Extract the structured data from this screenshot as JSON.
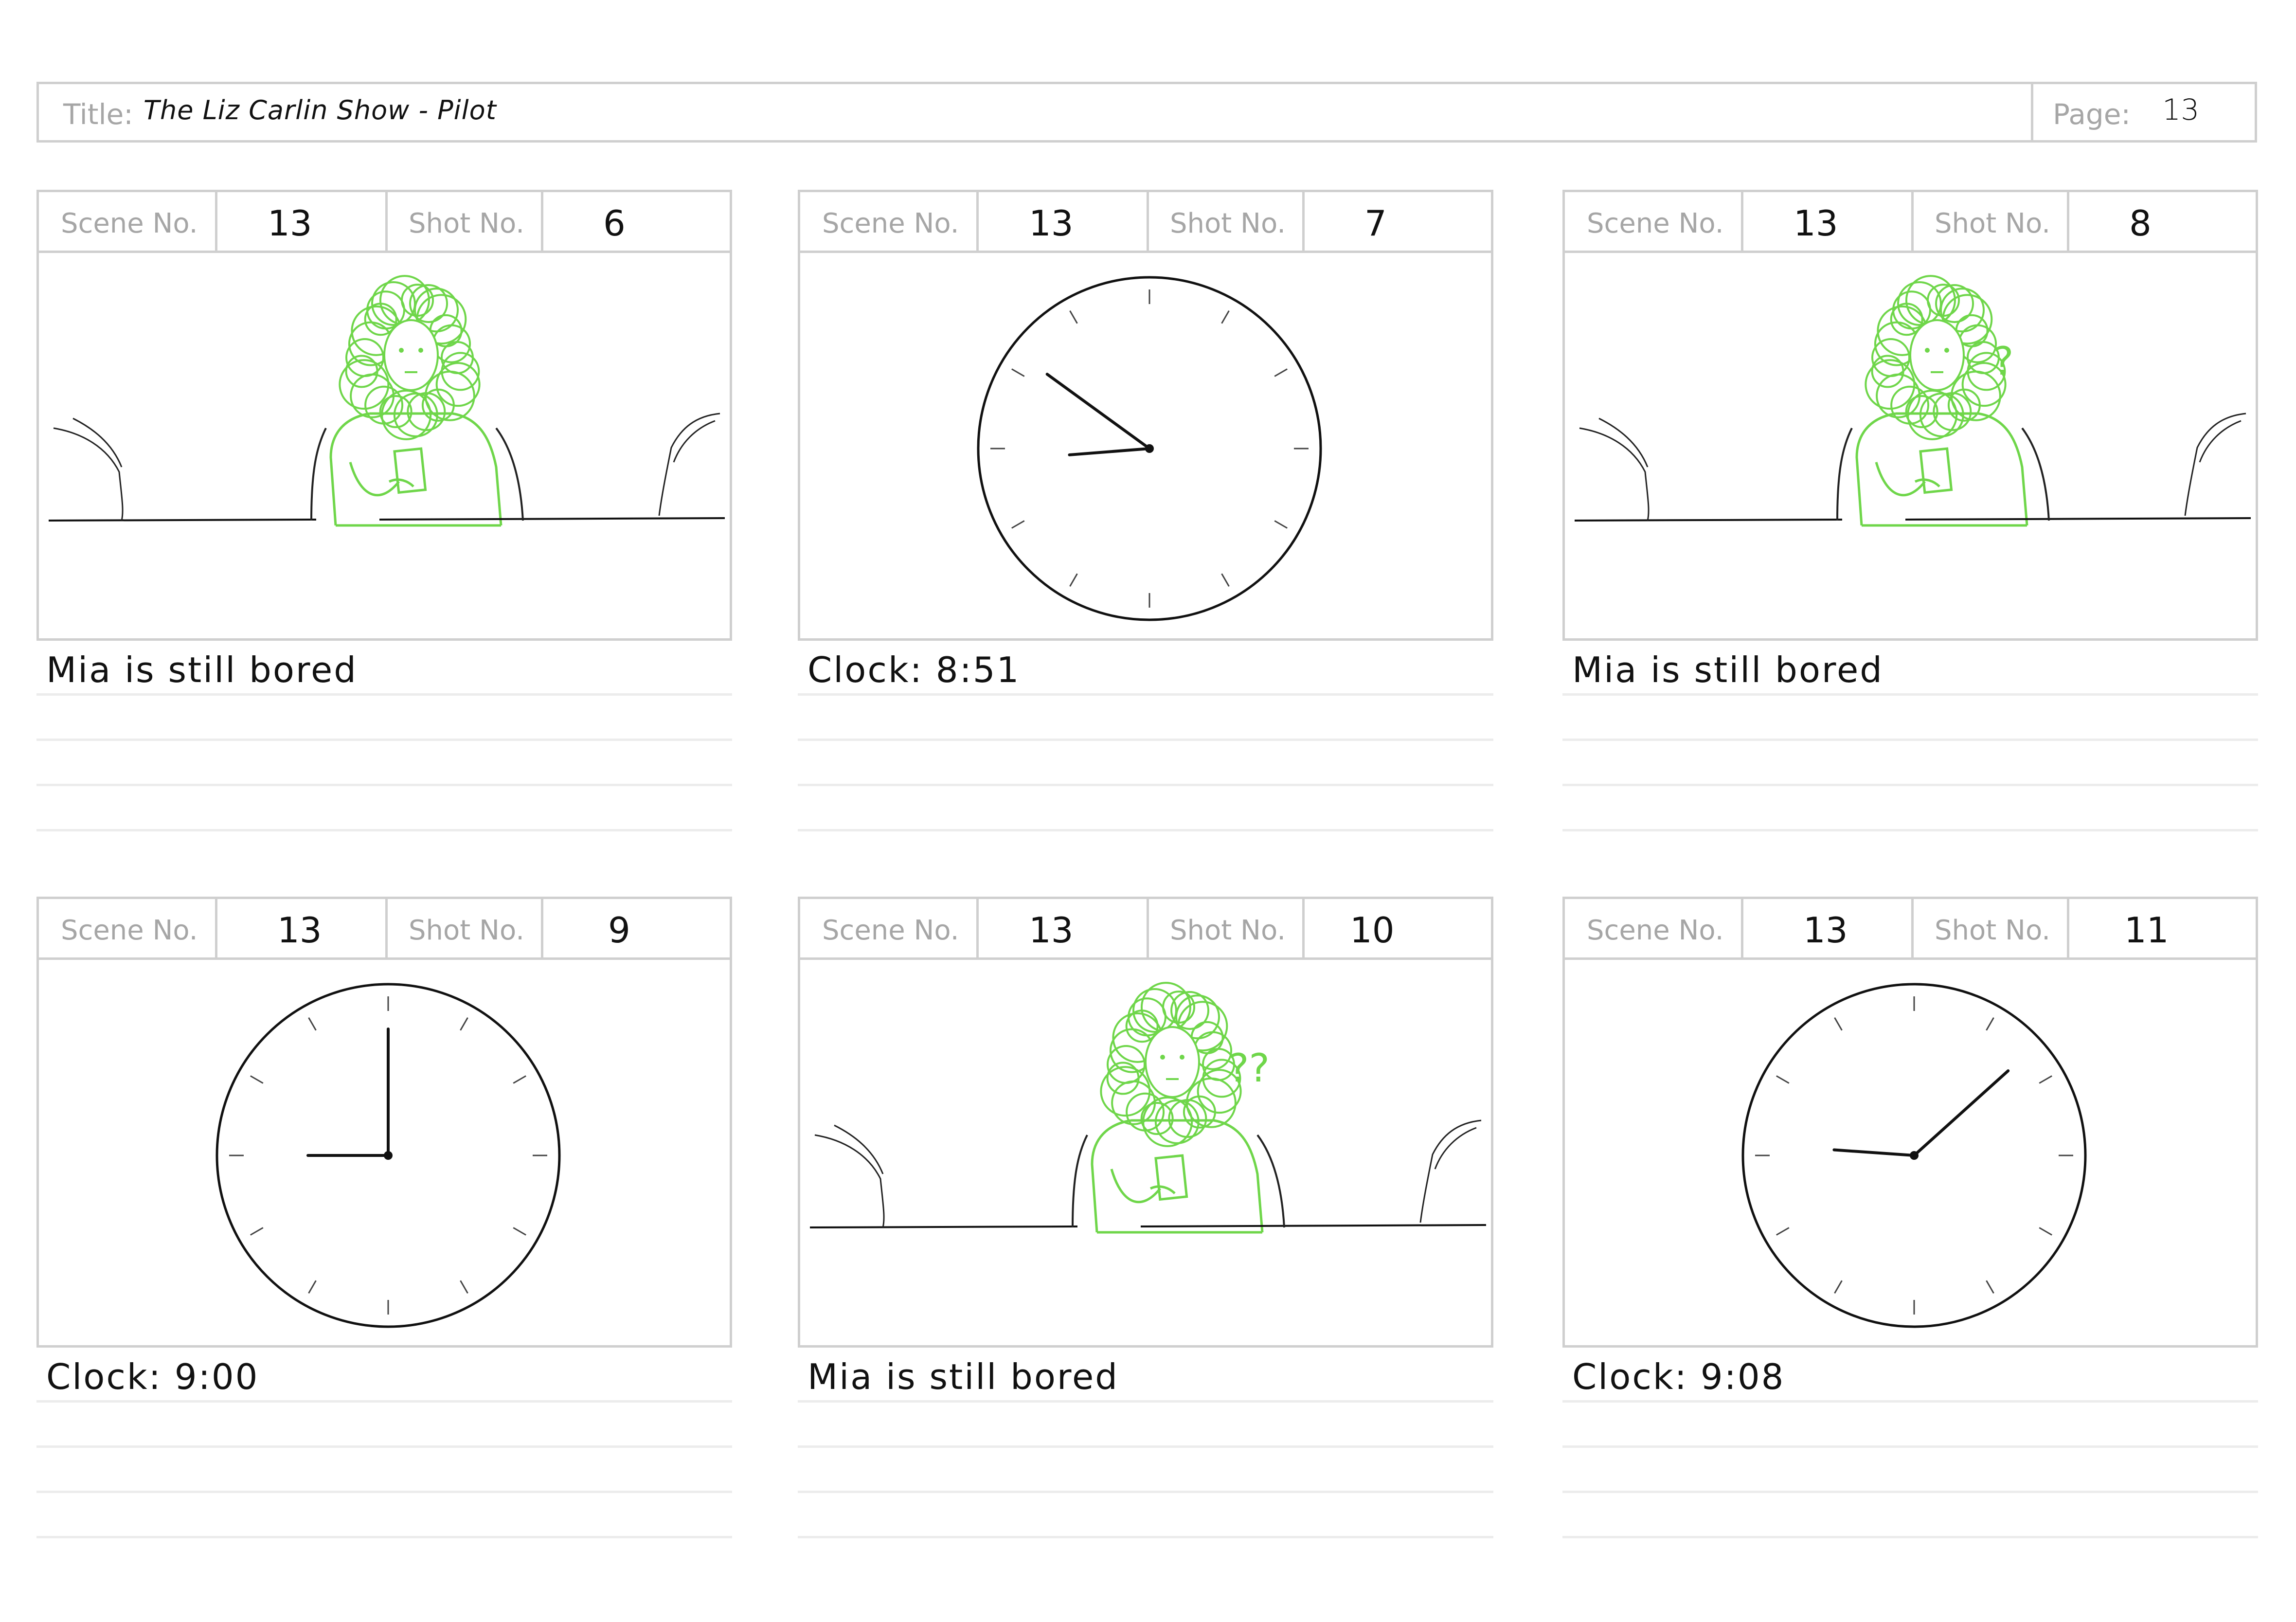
{
  "header": {
    "title_label": "Title:",
    "title_value": "The Liz Carlin Show - Pilot",
    "page_label": "Page:",
    "page_value": "13"
  },
  "labels": {
    "scene": "Scene No.",
    "shot": "Shot No."
  },
  "panels": [
    {
      "scene": "13",
      "shot": "6",
      "caption": "Mia is still bored",
      "kind": "mia",
      "marks": ""
    },
    {
      "scene": "13",
      "shot": "7",
      "caption": "Clock: 8:51",
      "kind": "clock",
      "time": "8:51"
    },
    {
      "scene": "13",
      "shot": "8",
      "caption": "Mia is still bored",
      "kind": "mia",
      "marks": "?"
    },
    {
      "scene": "13",
      "shot": "9",
      "caption": "Clock: 9:00",
      "kind": "clock",
      "time": "9:00"
    },
    {
      "scene": "13",
      "shot": "10",
      "caption": "Mia is still bored",
      "kind": "mia",
      "marks": "??"
    },
    {
      "scene": "13",
      "shot": "11",
      "caption": "Clock: 9:08",
      "kind": "clock",
      "time": "9:08"
    }
  ],
  "colors": {
    "sketch_green": "#6fd64a",
    "border": "#cfcfcf",
    "label_gray": "#a6a6a6"
  }
}
